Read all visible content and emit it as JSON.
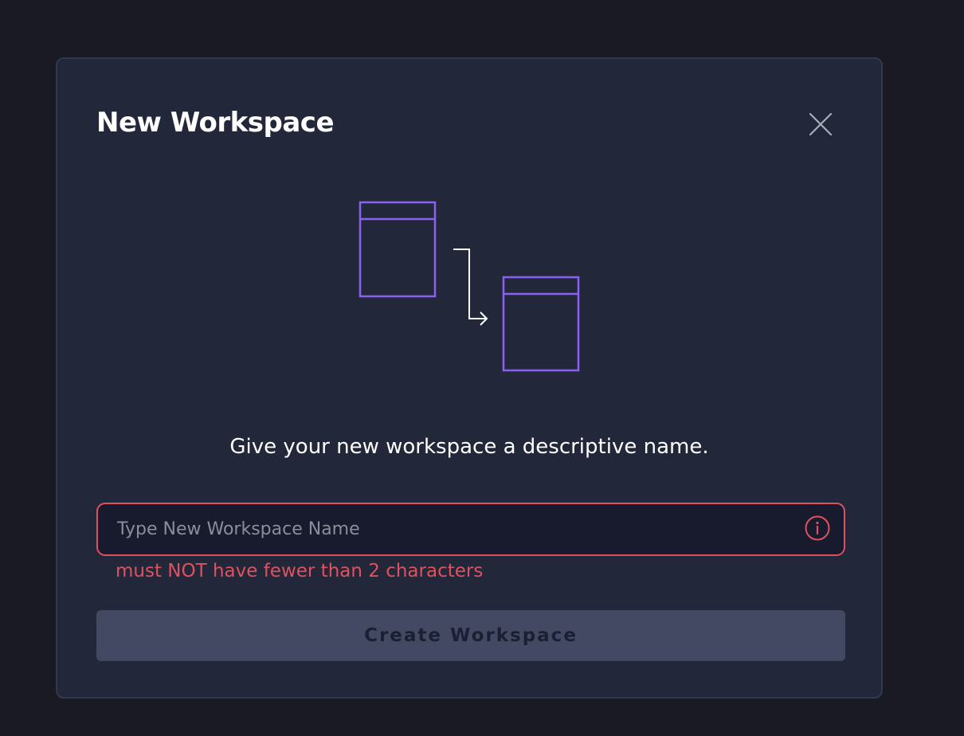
{
  "modal": {
    "title": "New Workspace",
    "description": "Give your new workspace a descriptive name.",
    "close_icon": "close-icon",
    "illustration_icon": "move-window-icon"
  },
  "form": {
    "input_value": "",
    "input_placeholder": "Type New Workspace Name",
    "info_icon": "info-icon",
    "error_message": "must NOT have fewer than 2 characters",
    "submit_label": "Create Workspace"
  },
  "colors": {
    "background": "#1a1a24",
    "modal_background": "#23273a",
    "accent_purple": "#8a62f2",
    "error_red": "#e0515f",
    "button_disabled": "#444963"
  }
}
